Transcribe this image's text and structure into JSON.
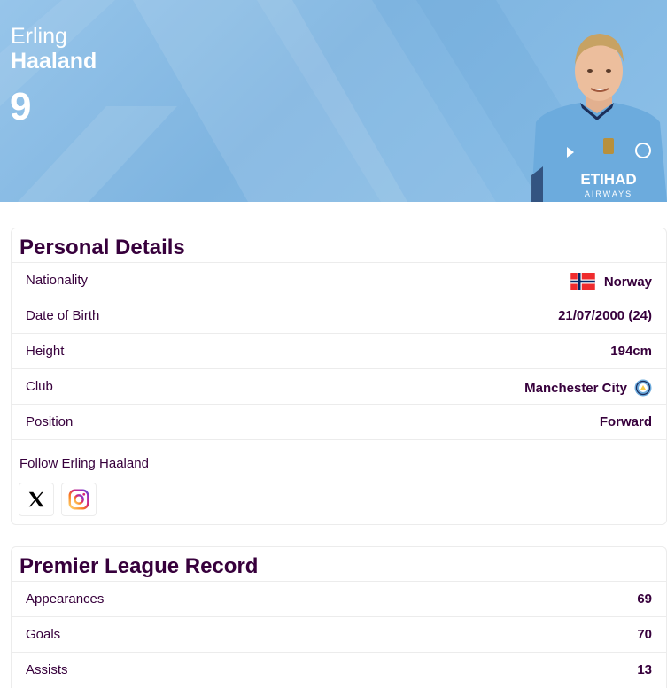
{
  "player": {
    "first_name": "Erling",
    "last_name": "Haaland",
    "shirt_number": "9"
  },
  "personal_details": {
    "title": "Personal Details",
    "rows": [
      {
        "label": "Nationality",
        "value": "Norway",
        "icon": "norway-flag"
      },
      {
        "label": "Date of Birth",
        "value": "21/07/2000 (24)"
      },
      {
        "label": "Height",
        "value": "194cm"
      },
      {
        "label": "Club",
        "value": "Manchester City",
        "icon": "man-city-badge"
      },
      {
        "label": "Position",
        "value": "Forward"
      }
    ],
    "follow_label": "Follow Erling Haaland",
    "socials": [
      {
        "name": "X",
        "icon": "x-icon"
      },
      {
        "name": "Instagram",
        "icon": "instagram-icon"
      }
    ]
  },
  "premier_league_record": {
    "title": "Premier League Record",
    "rows": [
      {
        "label": "Appearances",
        "value": "69"
      },
      {
        "label": "Goals",
        "value": "70"
      },
      {
        "label": "Assists",
        "value": "13"
      }
    ]
  },
  "colors": {
    "primary_text": "#37003c",
    "hero_blue": "#8cc0e8",
    "shirt_blue": "#6cabdd",
    "border": "#ececec"
  }
}
